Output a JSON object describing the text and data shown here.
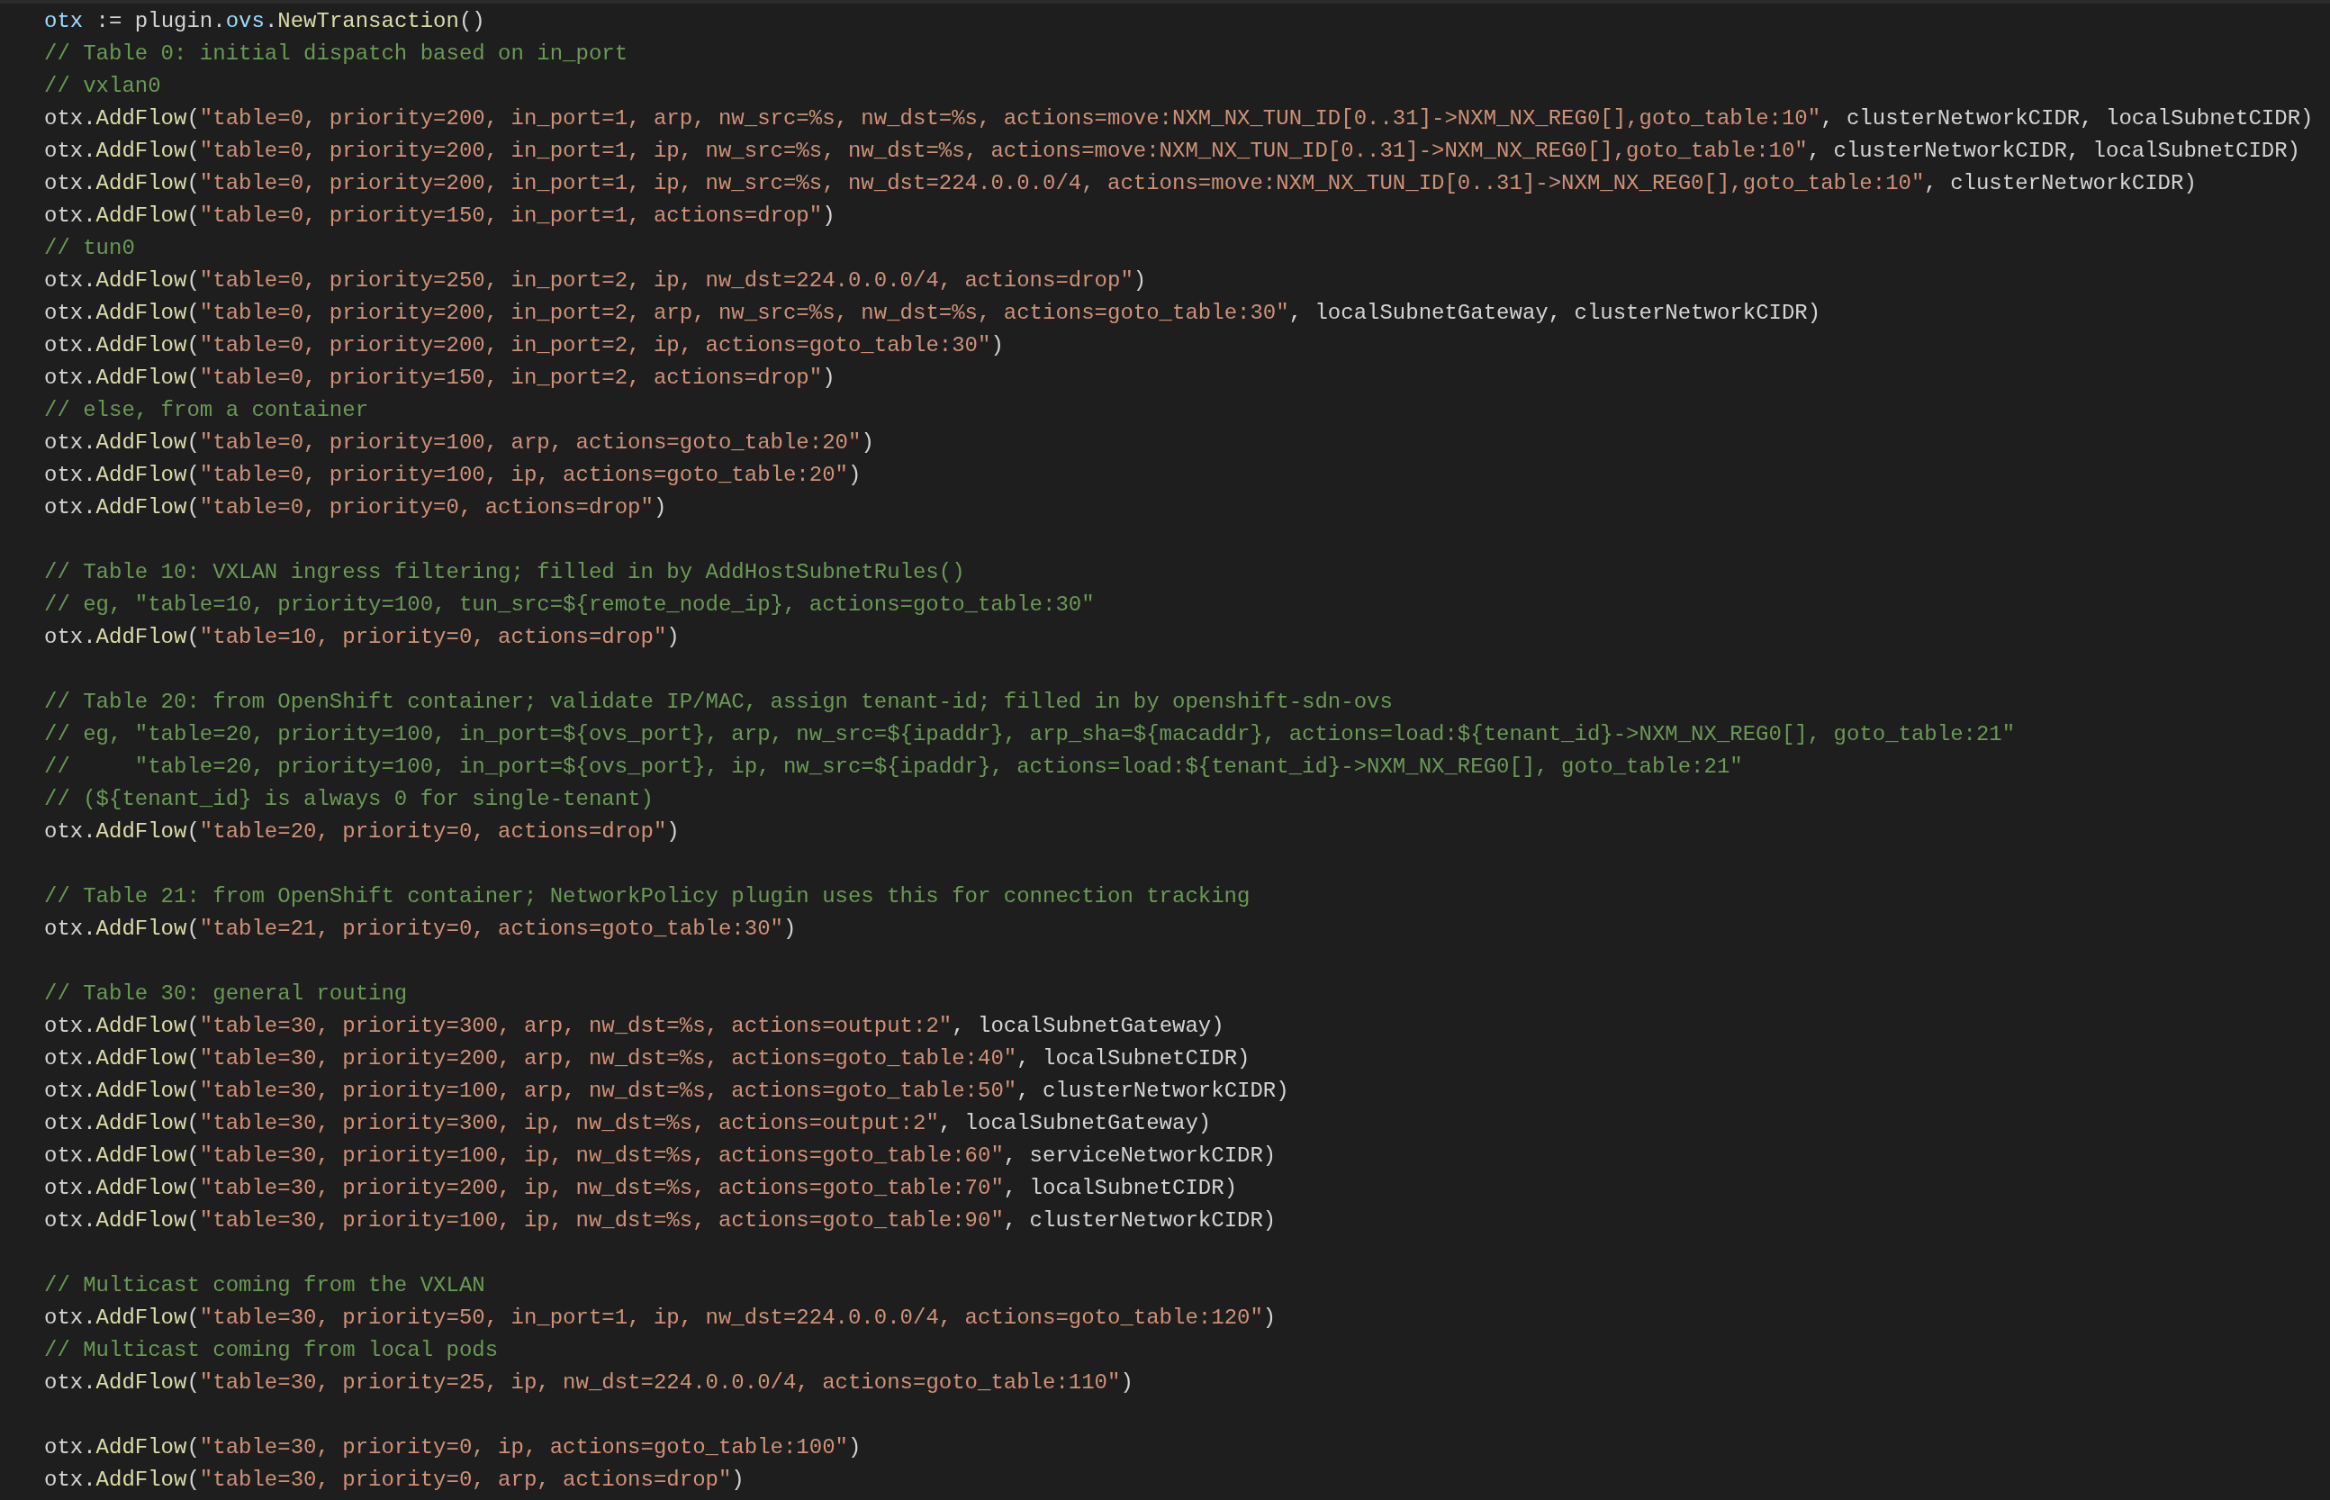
{
  "editor": {
    "blocks": [
      {
        "lines": [
          {
            "tokens": [
              {
                "kind": "variable",
                "text": "otx"
              },
              {
                "kind": "plain",
                "text": " := plugin."
              },
              {
                "kind": "variable",
                "text": "ovs"
              },
              {
                "kind": "plain",
                "text": "."
              },
              {
                "kind": "function",
                "text": "NewTransaction"
              },
              {
                "kind": "plain",
                "text": "()"
              }
            ]
          },
          {
            "tokens": [
              {
                "kind": "comment",
                "text": "// Table 0: initial dispatch based on in_port"
              }
            ]
          },
          {
            "tokens": [
              {
                "kind": "comment",
                "text": "// vxlan0"
              }
            ]
          },
          {
            "tokens": [
              {
                "kind": "plain",
                "text": "otx."
              },
              {
                "kind": "function",
                "text": "AddFlow"
              },
              {
                "kind": "plain",
                "text": "("
              },
              {
                "kind": "string",
                "text": "\"table=0, priority=200, in_port=1, arp, nw_src=%s, nw_dst=%s, actions=move:NXM_NX_TUN_ID[0..31]->NXM_NX_REG0[],goto_table:10\""
              },
              {
                "kind": "plain",
                "text": ", clusterNetworkCIDR, localSubnetCIDR)"
              }
            ]
          },
          {
            "tokens": [
              {
                "kind": "plain",
                "text": "otx."
              },
              {
                "kind": "function",
                "text": "AddFlow"
              },
              {
                "kind": "plain",
                "text": "("
              },
              {
                "kind": "string",
                "text": "\"table=0, priority=200, in_port=1, ip, nw_src=%s, nw_dst=%s, actions=move:NXM_NX_TUN_ID[0..31]->NXM_NX_REG0[],goto_table:10\""
              },
              {
                "kind": "plain",
                "text": ", clusterNetworkCIDR, localSubnetCIDR)"
              }
            ]
          },
          {
            "tokens": [
              {
                "kind": "plain",
                "text": "otx."
              },
              {
                "kind": "function",
                "text": "AddFlow"
              },
              {
                "kind": "plain",
                "text": "("
              },
              {
                "kind": "string",
                "text": "\"table=0, priority=200, in_port=1, ip, nw_src=%s, nw_dst=224.0.0.0/4, actions=move:NXM_NX_TUN_ID[0..31]->NXM_NX_REG0[],goto_table:10\""
              },
              {
                "kind": "plain",
                "text": ", clusterNetworkCIDR)"
              }
            ]
          },
          {
            "tokens": [
              {
                "kind": "plain",
                "text": "otx."
              },
              {
                "kind": "function",
                "text": "AddFlow"
              },
              {
                "kind": "plain",
                "text": "("
              },
              {
                "kind": "string",
                "text": "\"table=0, priority=150, in_port=1, actions=drop\""
              },
              {
                "kind": "plain",
                "text": ")"
              }
            ]
          },
          {
            "tokens": [
              {
                "kind": "comment",
                "text": "// tun0"
              }
            ]
          },
          {
            "tokens": [
              {
                "kind": "plain",
                "text": "otx."
              },
              {
                "kind": "function",
                "text": "AddFlow"
              },
              {
                "kind": "plain",
                "text": "("
              },
              {
                "kind": "string",
                "text": "\"table=0, priority=250, in_port=2, ip, nw_dst=224.0.0.0/4, actions=drop\""
              },
              {
                "kind": "plain",
                "text": ")"
              }
            ]
          },
          {
            "tokens": [
              {
                "kind": "plain",
                "text": "otx."
              },
              {
                "kind": "function",
                "text": "AddFlow"
              },
              {
                "kind": "plain",
                "text": "("
              },
              {
                "kind": "string",
                "text": "\"table=0, priority=200, in_port=2, arp, nw_src=%s, nw_dst=%s, actions=goto_table:30\""
              },
              {
                "kind": "plain",
                "text": ", localSubnetGateway, clusterNetworkCIDR)"
              }
            ]
          },
          {
            "tokens": [
              {
                "kind": "plain",
                "text": "otx."
              },
              {
                "kind": "function",
                "text": "AddFlow"
              },
              {
                "kind": "plain",
                "text": "("
              },
              {
                "kind": "string",
                "text": "\"table=0, priority=200, in_port=2, ip, actions=goto_table:30\""
              },
              {
                "kind": "plain",
                "text": ")"
              }
            ]
          },
          {
            "tokens": [
              {
                "kind": "plain",
                "text": "otx."
              },
              {
                "kind": "function",
                "text": "AddFlow"
              },
              {
                "kind": "plain",
                "text": "("
              },
              {
                "kind": "string",
                "text": "\"table=0, priority=150, in_port=2, actions=drop\""
              },
              {
                "kind": "plain",
                "text": ")"
              }
            ]
          },
          {
            "tokens": [
              {
                "kind": "comment",
                "text": "// else, from a container"
              }
            ]
          },
          {
            "tokens": [
              {
                "kind": "plain",
                "text": "otx."
              },
              {
                "kind": "function",
                "text": "AddFlow"
              },
              {
                "kind": "plain",
                "text": "("
              },
              {
                "kind": "string",
                "text": "\"table=0, priority=100, arp, actions=goto_table:20\""
              },
              {
                "kind": "plain",
                "text": ")"
              }
            ]
          },
          {
            "tokens": [
              {
                "kind": "plain",
                "text": "otx."
              },
              {
                "kind": "function",
                "text": "AddFlow"
              },
              {
                "kind": "plain",
                "text": "("
              },
              {
                "kind": "string",
                "text": "\"table=0, priority=100, ip, actions=goto_table:20\""
              },
              {
                "kind": "plain",
                "text": ")"
              }
            ]
          },
          {
            "tokens": [
              {
                "kind": "plain",
                "text": "otx."
              },
              {
                "kind": "function",
                "text": "AddFlow"
              },
              {
                "kind": "plain",
                "text": "("
              },
              {
                "kind": "string",
                "text": "\"table=0, priority=0, actions=drop\""
              },
              {
                "kind": "plain",
                "text": ")"
              }
            ]
          }
        ]
      },
      {
        "lines": [
          {
            "tokens": [
              {
                "kind": "comment",
                "text": "// Table 10: VXLAN ingress filtering; filled in by AddHostSubnetRules()"
              }
            ]
          },
          {
            "tokens": [
              {
                "kind": "comment",
                "text": "// eg, \"table=10, priority=100, tun_src=${remote_node_ip}, actions=goto_table:30\""
              }
            ]
          },
          {
            "tokens": [
              {
                "kind": "plain",
                "text": "otx."
              },
              {
                "kind": "function",
                "text": "AddFlow"
              },
              {
                "kind": "plain",
                "text": "("
              },
              {
                "kind": "string",
                "text": "\"table=10, priority=0, actions=drop\""
              },
              {
                "kind": "plain",
                "text": ")"
              }
            ]
          }
        ]
      },
      {
        "lines": [
          {
            "tokens": [
              {
                "kind": "comment",
                "text": "// Table 20: from OpenShift container; validate IP/MAC, assign tenant-id; filled in by openshift-sdn-ovs"
              }
            ]
          },
          {
            "tokens": [
              {
                "kind": "comment",
                "text": "// eg, \"table=20, priority=100, in_port=${ovs_port}, arp, nw_src=${ipaddr}, arp_sha=${macaddr}, actions=load:${tenant_id}->NXM_NX_REG0[], goto_table:21\""
              }
            ]
          },
          {
            "tokens": [
              {
                "kind": "comment",
                "text": "//     \"table=20, priority=100, in_port=${ovs_port}, ip, nw_src=${ipaddr}, actions=load:${tenant_id}->NXM_NX_REG0[], goto_table:21\""
              }
            ]
          },
          {
            "tokens": [
              {
                "kind": "comment",
                "text": "// (${tenant_id} is always 0 for single-tenant)"
              }
            ]
          },
          {
            "tokens": [
              {
                "kind": "plain",
                "text": "otx."
              },
              {
                "kind": "function",
                "text": "AddFlow"
              },
              {
                "kind": "plain",
                "text": "("
              },
              {
                "kind": "string",
                "text": "\"table=20, priority=0, actions=drop\""
              },
              {
                "kind": "plain",
                "text": ")"
              }
            ]
          }
        ]
      },
      {
        "lines": [
          {
            "tokens": [
              {
                "kind": "comment",
                "text": "// Table 21: from OpenShift container; NetworkPolicy plugin uses this for connection tracking"
              }
            ]
          },
          {
            "tokens": [
              {
                "kind": "plain",
                "text": "otx."
              },
              {
                "kind": "function",
                "text": "AddFlow"
              },
              {
                "kind": "plain",
                "text": "("
              },
              {
                "kind": "string",
                "text": "\"table=21, priority=0, actions=goto_table:30\""
              },
              {
                "kind": "plain",
                "text": ")"
              }
            ]
          }
        ]
      },
      {
        "lines": [
          {
            "tokens": [
              {
                "kind": "comment",
                "text": "// Table 30: general routing"
              }
            ]
          },
          {
            "tokens": [
              {
                "kind": "plain",
                "text": "otx."
              },
              {
                "kind": "function",
                "text": "AddFlow"
              },
              {
                "kind": "plain",
                "text": "("
              },
              {
                "kind": "string",
                "text": "\"table=30, priority=300, arp, nw_dst=%s, actions=output:2\""
              },
              {
                "kind": "plain",
                "text": ", localSubnetGateway)"
              }
            ]
          },
          {
            "tokens": [
              {
                "kind": "plain",
                "text": "otx."
              },
              {
                "kind": "function",
                "text": "AddFlow"
              },
              {
                "kind": "plain",
                "text": "("
              },
              {
                "kind": "string",
                "text": "\"table=30, priority=200, arp, nw_dst=%s, actions=goto_table:40\""
              },
              {
                "kind": "plain",
                "text": ", localSubnetCIDR)"
              }
            ]
          },
          {
            "tokens": [
              {
                "kind": "plain",
                "text": "otx."
              },
              {
                "kind": "function",
                "text": "AddFlow"
              },
              {
                "kind": "plain",
                "text": "("
              },
              {
                "kind": "string",
                "text": "\"table=30, priority=100, arp, nw_dst=%s, actions=goto_table:50\""
              },
              {
                "kind": "plain",
                "text": ", clusterNetworkCIDR)"
              }
            ]
          },
          {
            "tokens": [
              {
                "kind": "plain",
                "text": "otx."
              },
              {
                "kind": "function",
                "text": "AddFlow"
              },
              {
                "kind": "plain",
                "text": "("
              },
              {
                "kind": "string",
                "text": "\"table=30, priority=300, ip, nw_dst=%s, actions=output:2\""
              },
              {
                "kind": "plain",
                "text": ", localSubnetGateway)"
              }
            ]
          },
          {
            "tokens": [
              {
                "kind": "plain",
                "text": "otx."
              },
              {
                "kind": "function",
                "text": "AddFlow"
              },
              {
                "kind": "plain",
                "text": "("
              },
              {
                "kind": "string",
                "text": "\"table=30, priority=100, ip, nw_dst=%s, actions=goto_table:60\""
              },
              {
                "kind": "plain",
                "text": ", serviceNetworkCIDR)"
              }
            ]
          },
          {
            "tokens": [
              {
                "kind": "plain",
                "text": "otx."
              },
              {
                "kind": "function",
                "text": "AddFlow"
              },
              {
                "kind": "plain",
                "text": "("
              },
              {
                "kind": "string",
                "text": "\"table=30, priority=200, ip, nw_dst=%s, actions=goto_table:70\""
              },
              {
                "kind": "plain",
                "text": ", localSubnetCIDR)"
              }
            ]
          },
          {
            "tokens": [
              {
                "kind": "plain",
                "text": "otx."
              },
              {
                "kind": "function",
                "text": "AddFlow"
              },
              {
                "kind": "plain",
                "text": "("
              },
              {
                "kind": "string",
                "text": "\"table=30, priority=100, ip, nw_dst=%s, actions=goto_table:90\""
              },
              {
                "kind": "plain",
                "text": ", clusterNetworkCIDR)"
              }
            ]
          }
        ]
      },
      {
        "lines": [
          {
            "tokens": [
              {
                "kind": "comment",
                "text": "// Multicast coming from the VXLAN"
              }
            ]
          },
          {
            "tokens": [
              {
                "kind": "plain",
                "text": "otx."
              },
              {
                "kind": "function",
                "text": "AddFlow"
              },
              {
                "kind": "plain",
                "text": "("
              },
              {
                "kind": "string",
                "text": "\"table=30, priority=50, in_port=1, ip, nw_dst=224.0.0.0/4, actions=goto_table:120\""
              },
              {
                "kind": "plain",
                "text": ")"
              }
            ]
          },
          {
            "tokens": [
              {
                "kind": "comment",
                "text": "// Multicast coming from local pods"
              }
            ]
          },
          {
            "tokens": [
              {
                "kind": "plain",
                "text": "otx."
              },
              {
                "kind": "function",
                "text": "AddFlow"
              },
              {
                "kind": "plain",
                "text": "("
              },
              {
                "kind": "string",
                "text": "\"table=30, priority=25, ip, nw_dst=224.0.0.0/4, actions=goto_table:110\""
              },
              {
                "kind": "plain",
                "text": ")"
              }
            ]
          }
        ]
      },
      {
        "lines": [
          {
            "tokens": [
              {
                "kind": "plain",
                "text": "otx."
              },
              {
                "kind": "function",
                "text": "AddFlow"
              },
              {
                "kind": "plain",
                "text": "("
              },
              {
                "kind": "string",
                "text": "\"table=30, priority=0, ip, actions=goto_table:100\""
              },
              {
                "kind": "plain",
                "text": ")"
              }
            ]
          },
          {
            "tokens": [
              {
                "kind": "plain",
                "text": "otx."
              },
              {
                "kind": "function",
                "text": "AddFlow"
              },
              {
                "kind": "plain",
                "text": "("
              },
              {
                "kind": "string",
                "text": "\"table=30, priority=0, arp, actions=drop\""
              },
              {
                "kind": "plain",
                "text": ")"
              }
            ]
          }
        ]
      }
    ]
  }
}
